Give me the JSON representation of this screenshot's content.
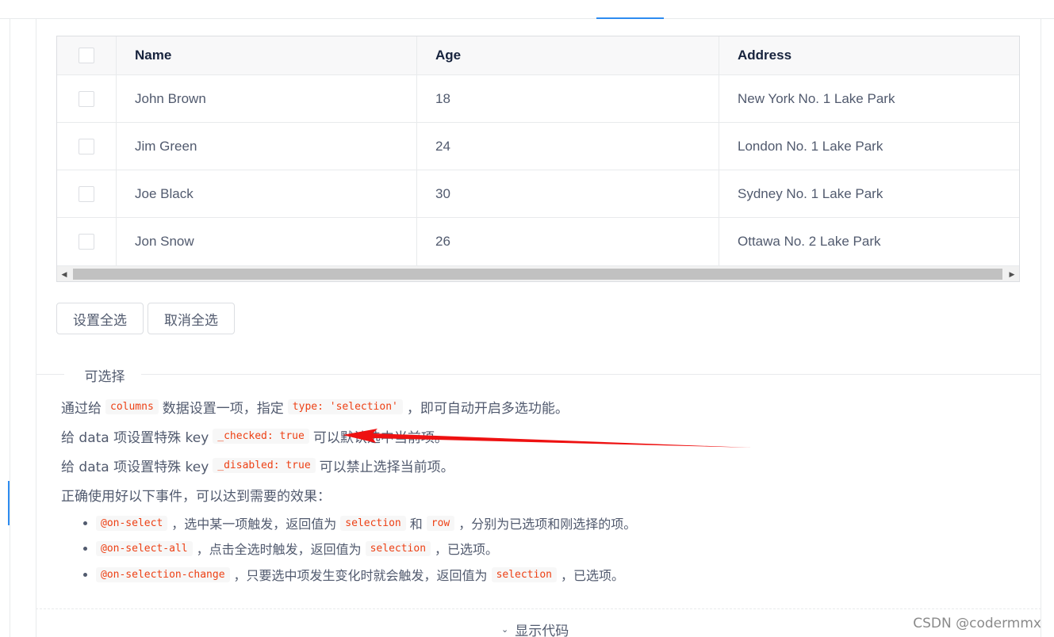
{
  "table": {
    "columns": [
      "Name",
      "Age",
      "Address"
    ],
    "rows": [
      {
        "name": "John Brown",
        "age": "18",
        "address": "New York No. 1 Lake Park"
      },
      {
        "name": "Jim Green",
        "age": "24",
        "address": "London No. 1 Lake Park"
      },
      {
        "name": "Joe Black",
        "age": "30",
        "address": "Sydney No. 1 Lake Park"
      },
      {
        "name": "Jon Snow",
        "age": "26",
        "address": "Ottawa No. 2 Lake Park"
      }
    ]
  },
  "buttons": {
    "select_all": "设置全选",
    "cancel_all": "取消全选"
  },
  "section": {
    "title": "可选择"
  },
  "description": {
    "line1": {
      "pre": "通过给",
      "code1": "columns",
      "mid": "数据设置一项，指定",
      "code2": "type: 'selection'",
      "post": "，即可自动开启多选功能。"
    },
    "line2": {
      "pre": "给 data 项设置特殊 key",
      "code": "_checked: true",
      "post": "可以默认选中当前项。"
    },
    "line3": {
      "pre": "给 data 项设置特殊 key",
      "code": "_disabled: true",
      "post": "可以禁止选择当前项。"
    },
    "line4": "正确使用好以下事件，可以达到需要的效果：",
    "bullets": [
      {
        "code": "@on-select",
        "t1": "，选中某一项触发，返回值为",
        "code2": "selection",
        "t2": "和",
        "code3": "row",
        "t3": "，分别为已选项和刚选择的项。"
      },
      {
        "code": "@on-select-all",
        "t1": "，点击全选时触发，返回值为",
        "code2": "selection",
        "t2": "，已选项。"
      },
      {
        "code": "@on-selection-change",
        "t1": "，只要选中项发生变化时就会触发，返回值为",
        "code2": "selection",
        "t2": "，已选项。"
      }
    ]
  },
  "footer": {
    "show_code": "显示代码"
  },
  "watermark": "CSDN @codermmx",
  "colors": {
    "accent": "#2d8cf0",
    "code_text": "#ed4014",
    "annotation_arrow": "#ee1111"
  }
}
